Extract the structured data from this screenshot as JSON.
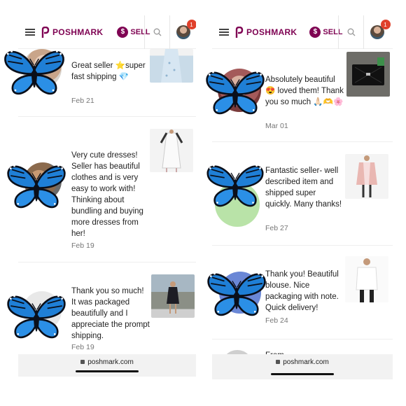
{
  "brand": {
    "logo_text": "POSHMARK",
    "sell_label": "SELL",
    "sell_icon": "$",
    "notification_count": "1",
    "accent": "#7f0353"
  },
  "left": {
    "reviews": [
      {
        "text": "Great seller ⭐super fast shipping 💎",
        "date": "Feb 21"
      },
      {
        "text": "Very cute dresses! Seller has beautiful clothes and is very easy to work with! Thinking about bundling and buying more dresses from her!",
        "date": "Feb 19"
      },
      {
        "text": "Thank you so much! It was packaged beautifully and I appreciate the prompt shipping.",
        "date": "Feb 19"
      }
    ],
    "url": "poshmark.com"
  },
  "right": {
    "reviews": [
      {
        "text": "Absolutely beautiful 😍 loved them! Thank you so much 🙏🏻🫶🌸",
        "date": "Mar 01"
      },
      {
        "text": "Fantastic seller- well described item and shipped super quickly. Many thanks!",
        "date": "Feb 27"
      },
      {
        "text": "Thank you! Beautiful blouse. Nice packaging with note. Quick delivery!",
        "date": "Feb 24"
      }
    ],
    "partial_text": "From",
    "url": "poshmark.com"
  }
}
